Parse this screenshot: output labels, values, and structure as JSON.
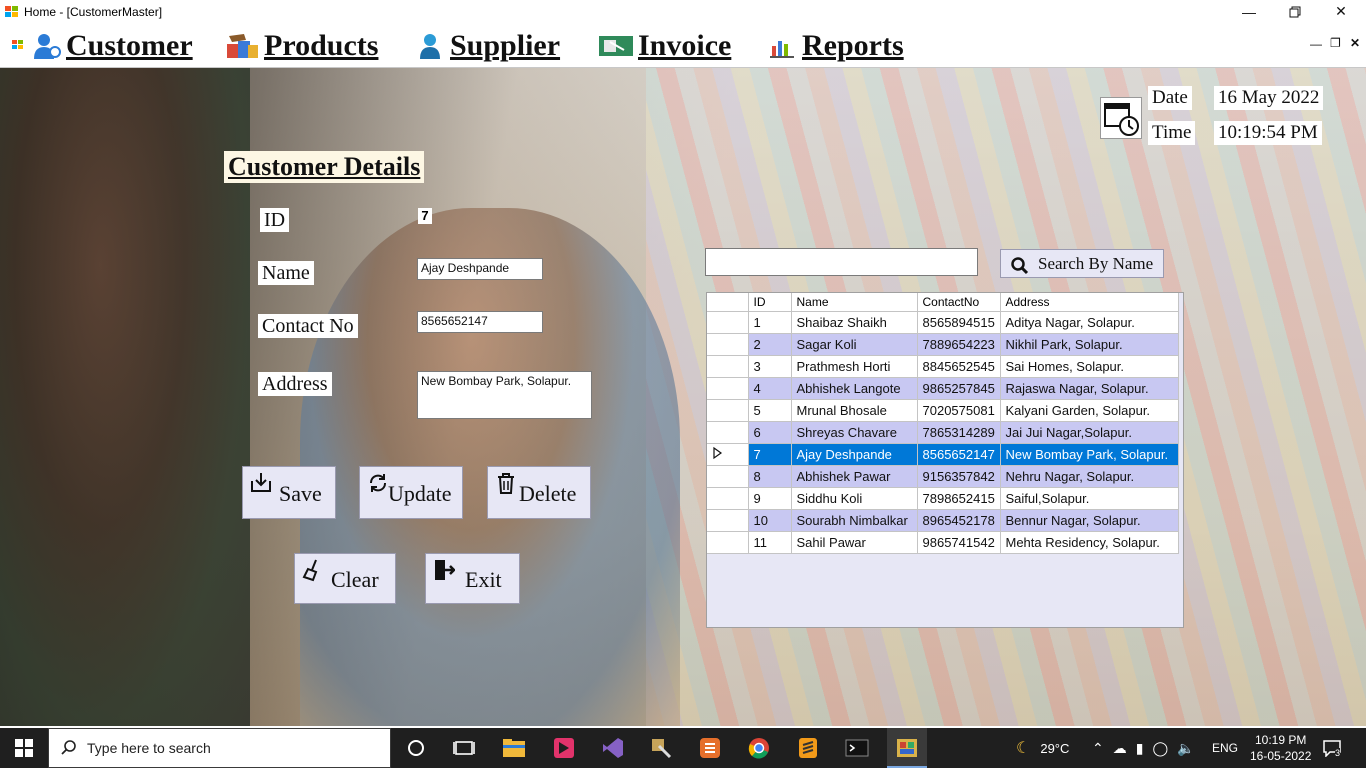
{
  "window": {
    "title": "Home - [CustomerMaster]"
  },
  "menu": {
    "items": [
      {
        "label": "Customer"
      },
      {
        "label": "Products"
      },
      {
        "label": "Supplier"
      },
      {
        "label": "Invoice"
      },
      {
        "label": "Reports"
      }
    ]
  },
  "datetime": {
    "date_label": "Date",
    "date_value": "16 May 2022",
    "time_label": "Time",
    "time_value": "10:19:54 PM"
  },
  "form": {
    "title": "Customer Details",
    "id_label": "ID",
    "id_value": "7",
    "name_label": "Name",
    "name_value": "Ajay Deshpande",
    "contact_label": "Contact No",
    "contact_value": "8565652147",
    "address_label": "Address",
    "address_value": "New Bombay Park, Solapur.",
    "buttons": {
      "save": "Save",
      "update": "Update",
      "delete": "Delete",
      "clear": "Clear",
      "exit": "Exit"
    }
  },
  "search": {
    "value": "",
    "button_label": "Search By Name"
  },
  "grid": {
    "columns": [
      "ID",
      "Name",
      "ContactNo",
      "Address"
    ],
    "selected_index": 6,
    "rows": [
      [
        "1",
        "Shaibaz Shaikh",
        "8565894515",
        "Aditya Nagar, Solapur."
      ],
      [
        "2",
        "Sagar Koli",
        "7889654223",
        "Nikhil Park, Solapur."
      ],
      [
        "3",
        "Prathmesh Horti",
        "8845652545",
        "Sai Homes, Solapur."
      ],
      [
        "4",
        "Abhishek Langote",
        "9865257845",
        "Rajaswa Nagar, Solapur."
      ],
      [
        "5",
        "Mrunal Bhosale",
        "7020575081",
        "Kalyani Garden, Solapur."
      ],
      [
        "6",
        "Shreyas Chavare",
        "7865314289",
        "Jai Jui Nagar,Solapur."
      ],
      [
        "7",
        "Ajay Deshpande",
        "8565652147",
        "New Bombay Park, Solapur."
      ],
      [
        "8",
        "Abhishek Pawar",
        "9156357842",
        "Nehru Nagar, Solapur."
      ],
      [
        "9",
        "Siddhu Koli",
        "7898652415",
        "Saiful,Solapur."
      ],
      [
        "10",
        "Sourabh Nimbalkar",
        "8965452178",
        "Bennur Nagar, Solapur."
      ],
      [
        "11",
        "Sahil Pawar",
        "9865741542",
        "Mehta Residency, Solapur."
      ]
    ]
  },
  "taskbar": {
    "search_placeholder": "Type here to search",
    "weather": "29°C",
    "language": "ENG",
    "clock_time": "10:19 PM",
    "clock_date": "16-05-2022",
    "notification_count": "3"
  },
  "colors": {
    "row_alt": "#c8c8f2",
    "row_selected": "#0078d7",
    "button_bg": "#e7e7f5",
    "taskbar": "#1f1f1f"
  }
}
